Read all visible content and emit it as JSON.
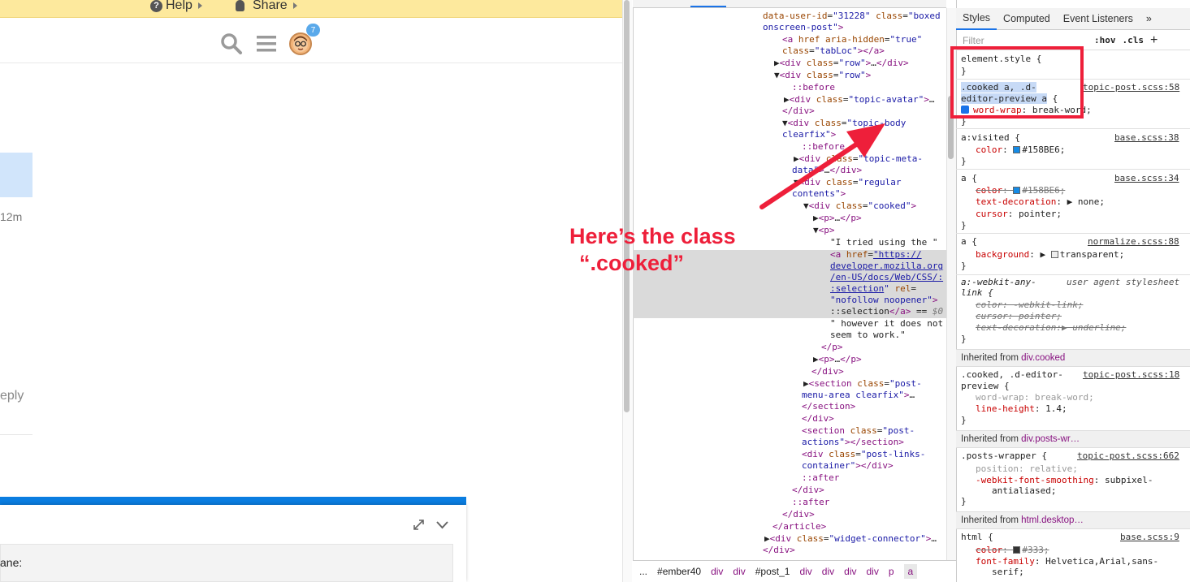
{
  "topbar": {
    "help": "Help",
    "share": "Share"
  },
  "header": {
    "notification_count": "7"
  },
  "timeline": {
    "time": "12m",
    "reply": "eply"
  },
  "composer": {
    "label": "ane:"
  },
  "devtools": {
    "elements_lines": [
      {
        "indent": 0,
        "html": "data-user-id=\"31228\" class=\"boxed"
      },
      {
        "indent": 0,
        "html": "onscreen-post\">"
      }
    ],
    "breadcrumbs": [
      "...",
      "#ember40",
      "div",
      "div",
      "#post_1",
      "div",
      "div",
      "div",
      "div",
      "p",
      "a"
    ],
    "styles_tabs": [
      "Styles",
      "Computed",
      "Event Listeners",
      "»"
    ],
    "filter_placeholder": "Filter",
    "hov": ":hov",
    "cls": ".cls",
    "add": "+"
  },
  "styles": {
    "element_style": "element.style {",
    "r1_sel": ".cooked a, .d-editor-preview a",
    "r1_src": "topic-post.scss:58",
    "r1_prop": "word-wrap",
    "r1_val": "break-word",
    "r2_sel": "a:visited",
    "r2_src": "base.scss:38",
    "r2_val": "#158BE6",
    "r3_sel": "a",
    "r3_src": "base.scss:34",
    "r4_sel": "a",
    "r4_src": "normalize.scss:88",
    "r5_sel": "a:-webkit-any-link",
    "r5_src": "user agent stylesheet",
    "inh1": "Inherited from",
    "inh1_el": "div.cooked",
    "r6_sel": ".cooked, .d-editor-preview",
    "r6_src": "topic-post.scss:18",
    "inh2_el": "div.posts-wr…",
    "r7_sel": ".posts-wrapper",
    "r7_src": "topic-post.scss:662",
    "inh3_el": "html.desktop…",
    "r8_sel": "html",
    "r8_src": "base.scss:9"
  },
  "annotation": {
    "line1": "Here’s the class",
    "line2": "“.cooked”"
  },
  "colors": {
    "annotation": "#ee1f3a",
    "link": "#158BE6",
    "accent": "#1a73e8",
    "banner": "#fde99d"
  }
}
